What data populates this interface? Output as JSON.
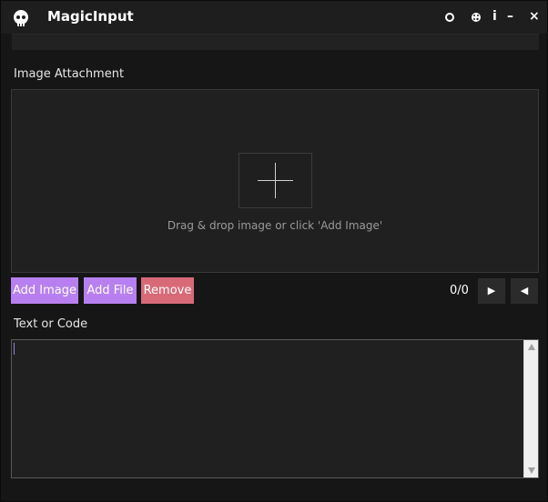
{
  "app": {
    "title": "MagicInput",
    "logo_icon": "skull-logo-icon"
  },
  "titlebar": {
    "icons": [
      "circle-icon",
      "palette-icon"
    ],
    "info_label": "i",
    "minimize_label": "–",
    "close_label": "×"
  },
  "image_section": {
    "label": "Image Attachment",
    "drop_hint": "Drag & drop image or click 'Add Image'",
    "add_icon": "plus-icon"
  },
  "buttons": {
    "add_image": "Add Image",
    "add_file": "Add File",
    "remove": "Remove"
  },
  "navigation": {
    "counter": "0/0",
    "next_label": "▶",
    "prev_label": "◀"
  },
  "text_section": {
    "label": "Text or Code",
    "value": ""
  },
  "colors": {
    "accent_purple": "#b77ff0",
    "danger_red": "#d86a78",
    "background": "#161616"
  }
}
